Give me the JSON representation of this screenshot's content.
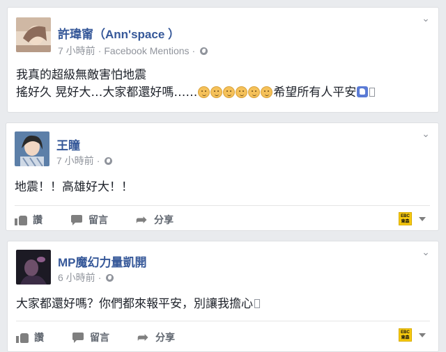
{
  "posts": [
    {
      "author": "許瑋甯（Ann'space ）",
      "time": "7 小時前",
      "source": "Facebook Mentions",
      "separator": "·",
      "line1": "我真的超級無敵害怕地震",
      "line2_start": "搖好久 晃好大…大家都還好嗎……",
      "line2_end": "希望所有人平安"
    },
    {
      "author": "王瞳",
      "time": "7 小時前",
      "separator": "·",
      "text": "地震！！高雄好大！！"
    },
    {
      "author": "MP魔幻力量凱開",
      "time": "6 小時前",
      "separator": "·",
      "text": "大家都還好嗎？你們都來報平安，別讓我擔心"
    }
  ],
  "actions": {
    "like": "讚",
    "comment": "留言",
    "share": "分享"
  },
  "brand_badge": "EBC 東森新聞",
  "icons": [
    "chevron-down-icon",
    "globe-icon",
    "like-icon",
    "comment-icon",
    "share-icon",
    "emoji-icon",
    "thumbs-up-icon"
  ],
  "colors": {
    "link": "#365899",
    "meta": "#90949c",
    "text": "#1d2129",
    "background": "#e9ebee",
    "badge": "#f7c90f"
  }
}
